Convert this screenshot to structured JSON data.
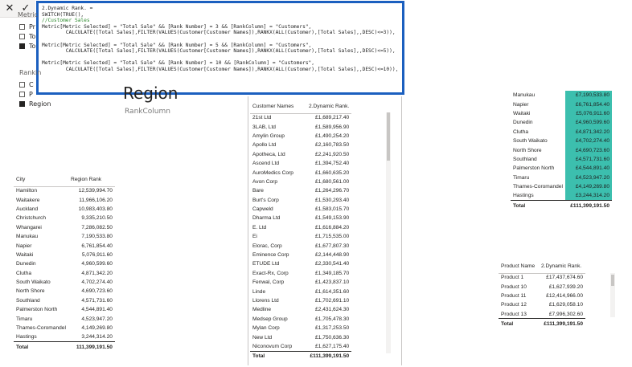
{
  "toolbar": {
    "cancel": "✕",
    "commit": "✓"
  },
  "formula": {
    "lines": [
      {
        "t": "2.Dynamic Rank. =",
        "c": "f-line"
      },
      {
        "t": "SWITCH(TRUE(),",
        "c": "f-line"
      },
      {
        "t": "//Customer Sales",
        "c": "f-comment"
      },
      {
        "t": "Metric[Metric Selected] = \"Total Sale\" && [Rank Number] = 3 && [RankColumn] = \"Customers\",",
        "c": "f-line"
      },
      {
        "t": "        CALCULATE([Total Sales],FILTER(VALUES(Customer[Customer Names]),RANKX(ALL(Customer),[Total Sales],,DESC)<=3)),",
        "c": "f-line"
      },
      {
        "t": "",
        "c": "f-line"
      },
      {
        "t": "Metric[Metric Selected] = \"Total Sale\" && [Rank Number] = 5 && [RankColumn] = \"Customers\",",
        "c": "f-line"
      },
      {
        "t": "        CALCULATE([Total Sales],FILTER(VALUES(Customer[Customer Names]),RANKX(ALL(Customer),[Total Sales],,DESC)<=5)),",
        "c": "f-line"
      },
      {
        "t": "",
        "c": "f-line"
      },
      {
        "t": "Metric[Metric Selected] = \"Total Sale\" && [Rank Number] = 10 && [RankColumn] = \"Customers\",",
        "c": "f-line"
      },
      {
        "t": "        CALCULATE([Total Sales],FILTER(VALUES(Customer[Customer Names]),RANKX(ALL(Customer),[Total Sales],,DESC)<=10)),",
        "c": "f-line"
      }
    ]
  },
  "metric_slicer": {
    "header": "Metric",
    "items": [
      {
        "label": "Pr",
        "checked": false
      },
      {
        "label": "To",
        "checked": false
      },
      {
        "label": "To",
        "checked": true
      }
    ]
  },
  "rank_slicer": {
    "header": "Rankin",
    "items": [
      {
        "label": "C",
        "checked": false
      },
      {
        "label": "P",
        "checked": false
      },
      {
        "label": "Region",
        "checked": true
      }
    ]
  },
  "card": {
    "title": "Region",
    "subtitle": "RankColumn"
  },
  "city_table": {
    "headers": [
      "City",
      "Region Rank"
    ],
    "rows": [
      [
        "Hamilton",
        "12,539,994.70"
      ],
      [
        "Waitakere",
        "11,966,106.20"
      ],
      [
        "Auckland",
        "10,983,403.80"
      ],
      [
        "Christchurch",
        "9,335,210.50"
      ],
      [
        "Whangarei",
        "7,286,082.50"
      ],
      [
        "Manukau",
        "7,190,533.80"
      ],
      [
        "Napier",
        "6,761,854.40"
      ],
      [
        "Waitaki",
        "5,076,911.60"
      ],
      [
        "Dunedin",
        "4,960,599.60"
      ],
      [
        "Clutha",
        "4,871,342.20"
      ],
      [
        "South Waikato",
        "4,702,274.40"
      ],
      [
        "North Shore",
        "4,690,723.60"
      ],
      [
        "Southland",
        "4,571,731.60"
      ],
      [
        "Palmerston North",
        "4,544,891.40"
      ],
      [
        "Timaru",
        "4,523,947.20"
      ],
      [
        "Thames-Coromandel",
        "4,149,269.80"
      ],
      [
        "Hastings",
        "3,244,314.20"
      ]
    ],
    "total_label": "Total",
    "total_value": "111,399,191.50"
  },
  "customer_table": {
    "headers": [
      "Customer Names",
      "2.Dynamic Rank."
    ],
    "rows": [
      [
        "21st Ltd",
        "£1,689,217.40"
      ],
      [
        "3LAB, Ltd",
        "£1,589,956.90"
      ],
      [
        "Amylin Group",
        "£1,490,254.20"
      ],
      [
        "Apollo Ltd",
        "£2,160,783.50"
      ],
      [
        "Apotheca, Ltd",
        "£2,241,920.50"
      ],
      [
        "Ascend Ltd",
        "£1,394,752.40"
      ],
      [
        "AuroMedics Corp",
        "£1,660,635.20"
      ],
      [
        "Avon Corp",
        "£1,680,561.00"
      ],
      [
        "Bare",
        "£1,264,296.70"
      ],
      [
        "Burt's Corp",
        "£1,530,293.40"
      ],
      [
        "Capweld",
        "£1,583,015.70"
      ],
      [
        "Dharma Ltd",
        "£1,549,153.90"
      ],
      [
        "E. Ltd",
        "£1,616,884.20"
      ],
      [
        "Ei",
        "£1,715,535.00"
      ],
      [
        "Elorac, Corp",
        "£1,677,807.30"
      ],
      [
        "Eminence Corp",
        "£2,144,448.90"
      ],
      [
        "ETUDE Ltd",
        "£2,330,541.40"
      ],
      [
        "Exact-Rx, Corp",
        "£1,349,185.70"
      ],
      [
        "Fenwal, Corp",
        "£1,423,837.10"
      ],
      [
        "Linde",
        "£1,614,351.60"
      ],
      [
        "Llorens Ltd",
        "£1,702,691.10"
      ],
      [
        "Medline",
        "£2,431,624.30"
      ],
      [
        "Medsep Group",
        "£1,705,478.30"
      ],
      [
        "Mylan Corp",
        "£1,317,253.50"
      ],
      [
        "New Ltd",
        "£1,750,636.30"
      ],
      [
        "Niconovum Corp",
        "£1,627,175.40"
      ]
    ],
    "total_label": "Total",
    "total_value": "£111,399,191.50"
  },
  "region_table": {
    "rows": [
      [
        "Manukau",
        "£7,190,533.80"
      ],
      [
        "Napier",
        "£6,761,854.40"
      ],
      [
        "Waitaki",
        "£5,076,911.60"
      ],
      [
        "Dunedin",
        "£4,960,599.60"
      ],
      [
        "Clutha",
        "£4,871,342.20"
      ],
      [
        "South Waikato",
        "£4,702,274.40"
      ],
      [
        "North Shore",
        "£4,690,723.60"
      ],
      [
        "Southland",
        "£4,571,731.60"
      ],
      [
        "Palmerston North",
        "£4,544,891.40"
      ],
      [
        "Timaru",
        "£4,523,947.20"
      ],
      [
        "Thames-Coromandel",
        "£4,149,269.80"
      ],
      [
        "Hastings",
        "£3,244,314.20"
      ]
    ],
    "total_label": "Total",
    "total_value": "£111,399,191.50",
    "highlight_color": "#3cbfae"
  },
  "product_table": {
    "headers": [
      "Product Name",
      "2.Dynamic Rank."
    ],
    "rows": [
      [
        "Product 1",
        "£17,437,674.60"
      ],
      [
        "Product 10",
        "£1,627,939.20"
      ],
      [
        "Product 11",
        "£12,414,966.00"
      ],
      [
        "Product 12",
        "£1,629,058.10"
      ],
      [
        "Product 13",
        "£7,996,302.60"
      ]
    ],
    "total_label": "Total",
    "total_value": "£111,399,191.50"
  }
}
